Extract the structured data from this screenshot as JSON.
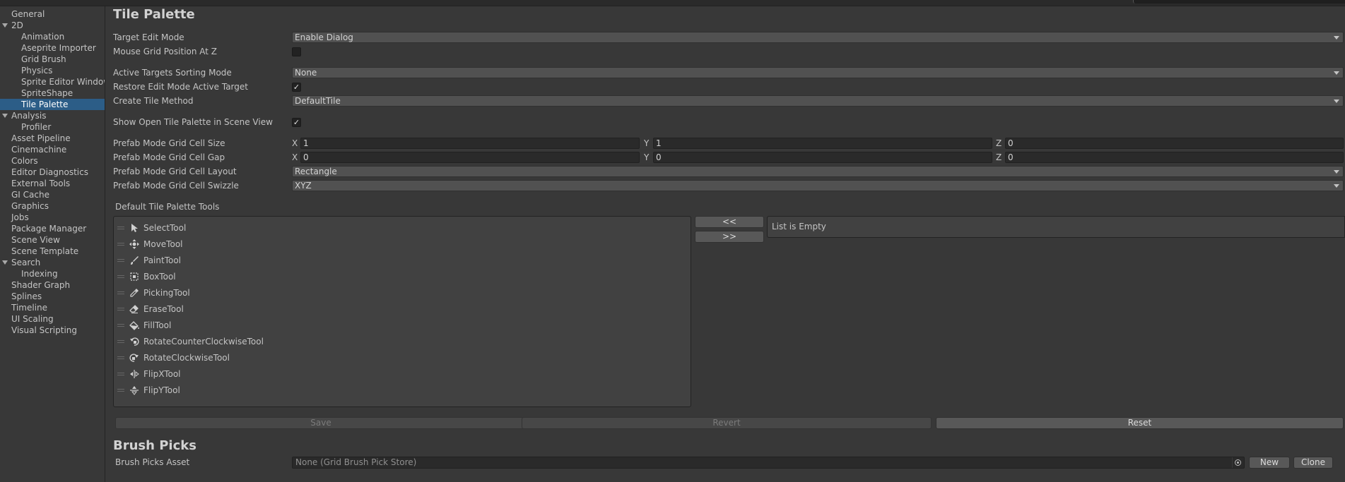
{
  "sidebar": {
    "items": [
      {
        "label": "General"
      },
      {
        "label": "2D"
      },
      {
        "label": "Animation"
      },
      {
        "label": "Aseprite Importer"
      },
      {
        "label": "Grid Brush"
      },
      {
        "label": "Physics"
      },
      {
        "label": "Sprite Editor Window"
      },
      {
        "label": "SpriteShape"
      },
      {
        "label": "Tile Palette"
      },
      {
        "label": "Analysis"
      },
      {
        "label": "Profiler"
      },
      {
        "label": "Asset Pipeline"
      },
      {
        "label": "Cinemachine"
      },
      {
        "label": "Colors"
      },
      {
        "label": "Editor Diagnostics"
      },
      {
        "label": "External Tools"
      },
      {
        "label": "GI Cache"
      },
      {
        "label": "Graphics"
      },
      {
        "label": "Jobs"
      },
      {
        "label": "Package Manager"
      },
      {
        "label": "Scene View"
      },
      {
        "label": "Scene Template"
      },
      {
        "label": "Search"
      },
      {
        "label": "Indexing"
      },
      {
        "label": "Shader Graph"
      },
      {
        "label": "Splines"
      },
      {
        "label": "Timeline"
      },
      {
        "label": "UI Scaling"
      },
      {
        "label": "Visual Scripting"
      }
    ],
    "selected": "Tile Palette"
  },
  "tile_palette": {
    "title": "Tile Palette",
    "target_edit_mode": {
      "label": "Target Edit Mode",
      "value": "Enable Dialog"
    },
    "mouse_grid_position": {
      "label": "Mouse Grid Position At Z",
      "checked": false
    },
    "active_targets_sorting": {
      "label": "Active Targets Sorting Mode",
      "value": "None"
    },
    "restore_edit_mode": {
      "label": "Restore Edit Mode Active Target",
      "checked": true,
      "check_glyph": "✓"
    },
    "create_tile_method": {
      "label": "Create Tile Method",
      "value": "DefaultTile"
    },
    "show_open_tile_palette": {
      "label": "Show Open Tile Palette in Scene View",
      "checked": true,
      "check_glyph": "✓"
    },
    "cell_size": {
      "label": "Prefab Mode Grid Cell Size",
      "x_label": "X",
      "y_label": "Y",
      "z_label": "Z",
      "x": "1",
      "y": "1",
      "z": "0"
    },
    "cell_gap": {
      "label": "Prefab Mode Grid Cell Gap",
      "x_label": "X",
      "y_label": "Y",
      "z_label": "Z",
      "x": "0",
      "y": "0",
      "z": "0"
    },
    "cell_layout": {
      "label": "Prefab Mode Grid Cell Layout",
      "value": "Rectangle"
    },
    "cell_swizzle": {
      "label": "Prefab Mode Grid Cell Swizzle",
      "value": "XYZ"
    },
    "default_tools": {
      "label": "Default Tile Palette Tools",
      "tools": [
        {
          "name": "SelectTool",
          "icon": "select-icon"
        },
        {
          "name": "MoveTool",
          "icon": "move-icon"
        },
        {
          "name": "PaintTool",
          "icon": "paint-icon"
        },
        {
          "name": "BoxTool",
          "icon": "box-icon"
        },
        {
          "name": "PickingTool",
          "icon": "picking-icon"
        },
        {
          "name": "EraseTool",
          "icon": "erase-icon"
        },
        {
          "name": "FillTool",
          "icon": "fill-icon"
        },
        {
          "name": "RotateCounterClockwiseTool",
          "icon": "rotate-ccw-icon"
        },
        {
          "name": "RotateClockwiseTool",
          "icon": "rotate-cw-icon"
        },
        {
          "name": "FlipXTool",
          "icon": "flip-x-icon"
        },
        {
          "name": "FlipYTool",
          "icon": "flip-y-icon"
        }
      ],
      "move_left_label": "<<",
      "move_right_label": ">>",
      "empty_text": "List is Empty"
    },
    "actions": {
      "save": "Save",
      "revert": "Revert",
      "reset": "Reset"
    }
  },
  "brush_picks": {
    "title": "Brush Picks",
    "asset_label": "Brush Picks Asset",
    "asset_value": "None (Grid Brush Pick Store)",
    "new_label": "New",
    "clone_label": "Clone"
  }
}
